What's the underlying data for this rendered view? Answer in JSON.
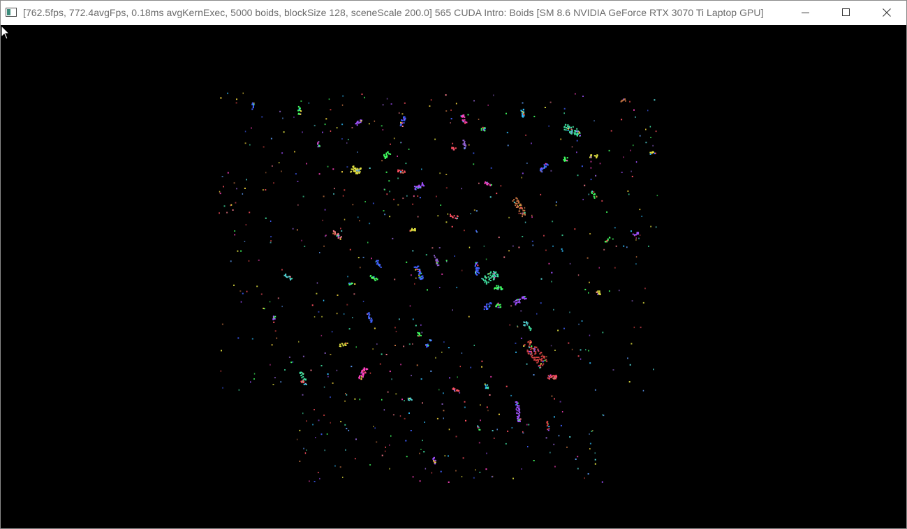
{
  "window": {
    "title": "[762.5fps, 772.4avgFps, 0.18ms avgKernExec, 5000 boids, blockSize 128, sceneScale 200.0] 565 CUDA Intro: Boids [SM 8.6 NVIDIA GeForce RTX 3070 Ti Laptop GPU]",
    "icon": "console-window-icon",
    "controls": {
      "minimize": "minimize-icon",
      "maximize": "maximize-icon",
      "close": "close-icon"
    }
  },
  "scene": {
    "background": "#000000",
    "palette": [
      "#3fe0a0",
      "#4060ff",
      "#ff5060",
      "#ffe040",
      "#a050ff",
      "#40ff60",
      "#ff8090",
      "#30c0ff",
      "#c07040",
      "#ff40c0",
      "#60a0ff",
      "#e0e040",
      "#50d0d0",
      "#9060d0",
      "#d04040"
    ]
  }
}
